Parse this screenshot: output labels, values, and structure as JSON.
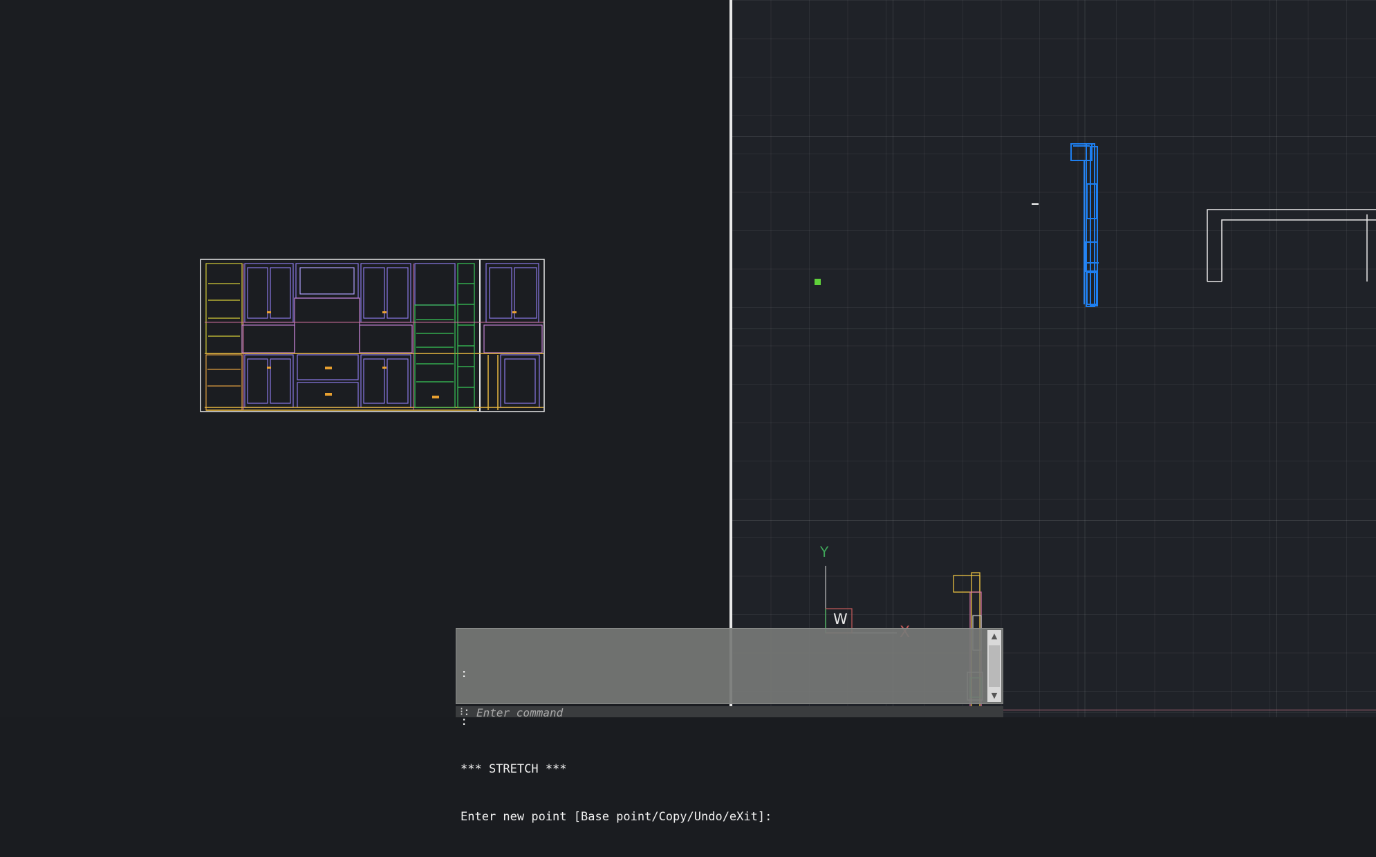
{
  "command_line": {
    "history": [
      ":",
      ":",
      "*** STRETCH ***",
      "Enter new point [Base point/Copy/Undo/eXit]:"
    ],
    "prompt_glyph": "⁝:",
    "placeholder": "Enter command"
  },
  "ucs_icon": {
    "x_label": "X",
    "y_label": "Y",
    "w_label": "W"
  },
  "colors": {
    "left_background": "#1b1d21",
    "right_background": "#1f2228",
    "selection_blue": "#1e7ff0",
    "grip_green": "#5fd13a",
    "ucs_x": "#c85a5a",
    "ucs_y": "#3fa65a"
  }
}
